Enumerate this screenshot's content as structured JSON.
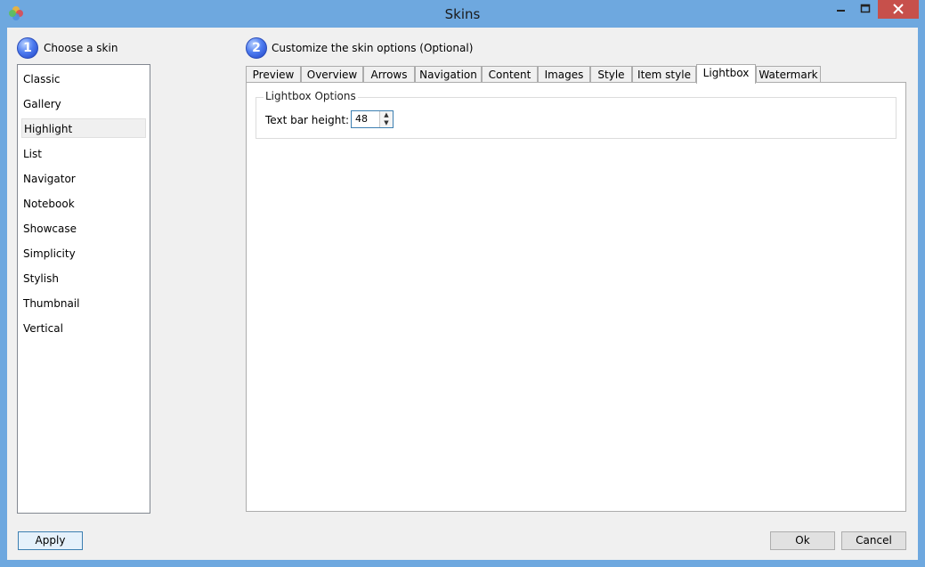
{
  "window": {
    "title": "Skins"
  },
  "step1": {
    "number": "1",
    "label": "Choose a skin"
  },
  "step2": {
    "number": "2",
    "label": "Customize the skin options (Optional)"
  },
  "skins": [
    "Classic",
    "Gallery",
    "Highlight",
    "List",
    "Navigator",
    "Notebook",
    "Showcase",
    "Simplicity",
    "Stylish",
    "Thumbnail",
    "Vertical"
  ],
  "selected_skin": "Highlight",
  "tabs": [
    "Preview",
    "Overview",
    "Arrows",
    "Navigation",
    "Content",
    "Images",
    "Style",
    "Item style",
    "Lightbox",
    "Watermark"
  ],
  "active_tab": "Lightbox",
  "lightbox": {
    "group_title": "Lightbox Options",
    "text_bar_height_label": "Text bar height:",
    "text_bar_height_value": "48"
  },
  "buttons": {
    "apply": "Apply",
    "ok": "Ok",
    "cancel": "Cancel"
  },
  "colors": {
    "frame": "#6ea8df",
    "close": "#c7504b",
    "step_circle": "#3a63e0"
  }
}
